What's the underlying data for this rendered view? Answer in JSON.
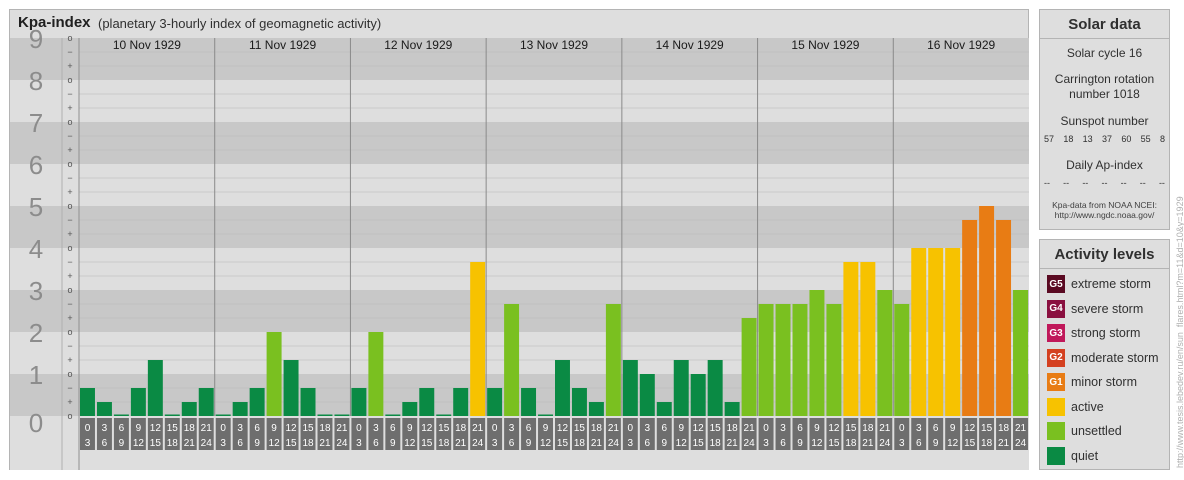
{
  "title": "Kpa-index",
  "subtitle": "(planetary 3-hourly index of geomagnetic activity)",
  "chart_data": {
    "type": "bar",
    "y_levels": [
      "0",
      "1",
      "2",
      "3",
      "4",
      "5",
      "6",
      "7",
      "8",
      "9"
    ],
    "sub_ticks": [
      "−",
      "+",
      "o"
    ],
    "ylim": [
      0,
      9
    ],
    "days": [
      {
        "date": "10 Nov 1929",
        "values": [
          0.667,
          0.333,
          0,
          0.667,
          1.333,
          0,
          0.333,
          0.667
        ]
      },
      {
        "date": "11 Nov 1929",
        "values": [
          0,
          0.333,
          0.667,
          2,
          1.333,
          0.667,
          0,
          0
        ]
      },
      {
        "date": "12 Nov 1929",
        "values": [
          0.667,
          2,
          0,
          0.333,
          0.667,
          0,
          0.667,
          3.667
        ]
      },
      {
        "date": "13 Nov 1929",
        "values": [
          0.667,
          2.667,
          0.667,
          0,
          1.333,
          0.667,
          0.333,
          2.667
        ]
      },
      {
        "date": "14 Nov 1929",
        "values": [
          1.333,
          1,
          0.333,
          1.333,
          1,
          1.333,
          0.333,
          2.333
        ]
      },
      {
        "date": "15 Nov 1929",
        "values": [
          2.667,
          2.667,
          2.667,
          3,
          2.667,
          3.667,
          3.667,
          3
        ]
      },
      {
        "date": "16 Nov 1929",
        "values": [
          2.667,
          4,
          4,
          4,
          4.667,
          5,
          4.667,
          3
        ]
      }
    ],
    "interval_top": [
      "0",
      "3",
      "6",
      "9",
      "12",
      "15",
      "18",
      "21"
    ],
    "interval_bottom": [
      "3",
      "6",
      "9",
      "12",
      "15",
      "18",
      "21",
      "24"
    ],
    "colors": {
      "quiet": "#0a8a44",
      "unsettled": "#7ac020",
      "active": "#f7c200",
      "minor": "#e87c14",
      "band_dark": "#c8c8c8",
      "band_light": "#dedede"
    }
  },
  "solar": {
    "title": "Solar data",
    "cycle": "Solar cycle 16",
    "carrington_line1": "Carrington rotation",
    "carrington_line2": "number 1018",
    "sunspot_title": "Sunspot number",
    "sunspots": [
      "57",
      "18",
      "13",
      "37",
      "60",
      "55",
      "8"
    ],
    "ap_title": "Daily Ap-index",
    "ap": [
      "--",
      "--",
      "--",
      "--",
      "--",
      "--",
      "--"
    ],
    "source_line1": "Kpa-data from NOAA NCEI:",
    "source_line2": "http://www.ngdc.noaa.gov/"
  },
  "activity": {
    "title": "Activity levels",
    "items": [
      {
        "code": "G5",
        "label": "extreme storm",
        "color": "#5a0a22"
      },
      {
        "code": "G4",
        "label": "severe storm",
        "color": "#8a1040"
      },
      {
        "code": "G3",
        "label": "strong storm",
        "color": "#c0185a"
      },
      {
        "code": "G2",
        "label": "moderate storm",
        "color": "#d44020"
      },
      {
        "code": "G1",
        "label": "minor storm",
        "color": "#e87c14"
      },
      {
        "code": "",
        "label": "active",
        "color": "#f7c200"
      },
      {
        "code": "",
        "label": "unsettled",
        "color": "#7ac020"
      },
      {
        "code": "",
        "label": "quiet",
        "color": "#0a8a44"
      }
    ]
  },
  "watermark": "http://www.tesis.lebedev.ru/en/sun_flares.html?m=11&d=10&y=1929"
}
